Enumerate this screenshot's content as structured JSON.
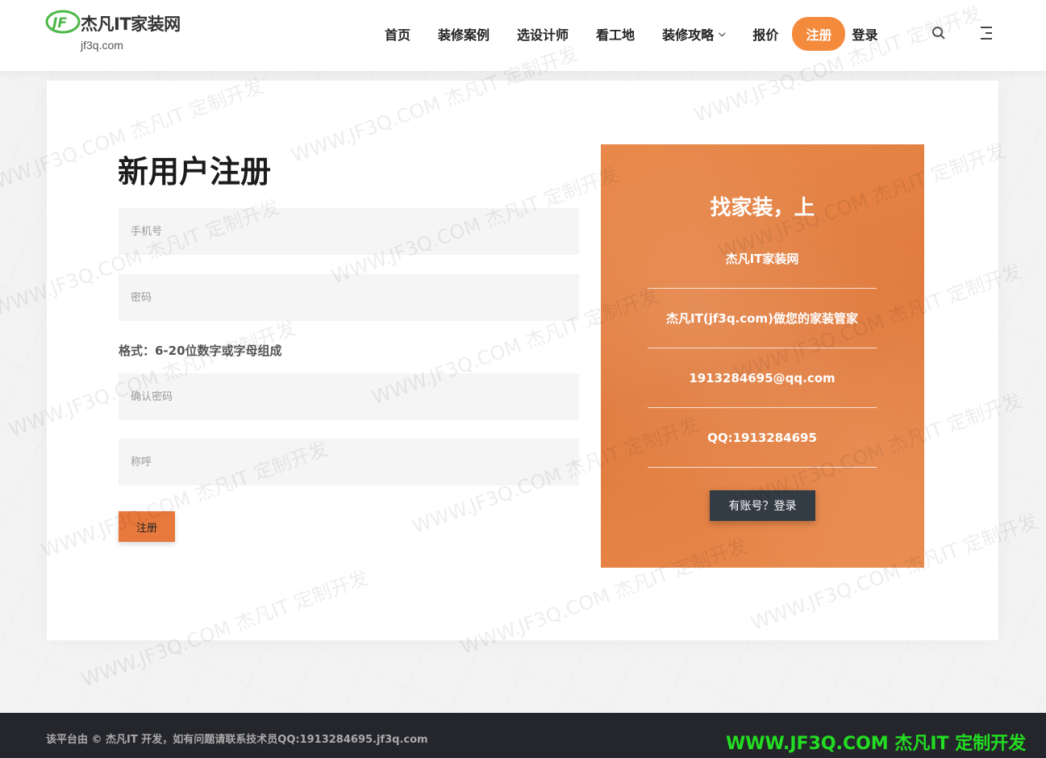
{
  "header": {
    "logo_text": "杰凡IT家装网",
    "logo_sub": "jf3q.com",
    "nav": [
      {
        "label": "首页"
      },
      {
        "label": "装修案例"
      },
      {
        "label": "选设计师"
      },
      {
        "label": "看工地"
      },
      {
        "label": "装修攻略"
      },
      {
        "label": "报价"
      }
    ],
    "register_label": "注册",
    "login_label": "登录"
  },
  "form": {
    "title": "新用户注册",
    "phone_placeholder": "手机号",
    "password_placeholder": "密码",
    "password_hint": "格式：6-20位数字或字母组成",
    "confirm_placeholder": "确认密码",
    "nickname_placeholder": "称呼",
    "submit_label": "注册"
  },
  "panel": {
    "title": "找家装，上",
    "rows": [
      "杰凡IT家装网",
      "杰凡IT(jf3q.com)做您的家装管家",
      "1913284695@qq.com",
      "QQ:1913284695"
    ],
    "login_button": "有账号？登录"
  },
  "footer": {
    "text": "该平台由 © 杰凡IT 开发，如有问题请联系技术员QQ:1913284695.jf3q.com",
    "brand": "WWW.JF3Q.COM 杰凡IT  定制开发"
  },
  "watermark": {
    "text": "WWW.JF3Q.COM 杰凡IT  定制开发"
  },
  "colors": {
    "accent": "#f48a3c",
    "panel": "#e07a3c",
    "dark_button": "#333b45",
    "footer_bg": "#25262b",
    "brand_green": "#22dd22"
  }
}
